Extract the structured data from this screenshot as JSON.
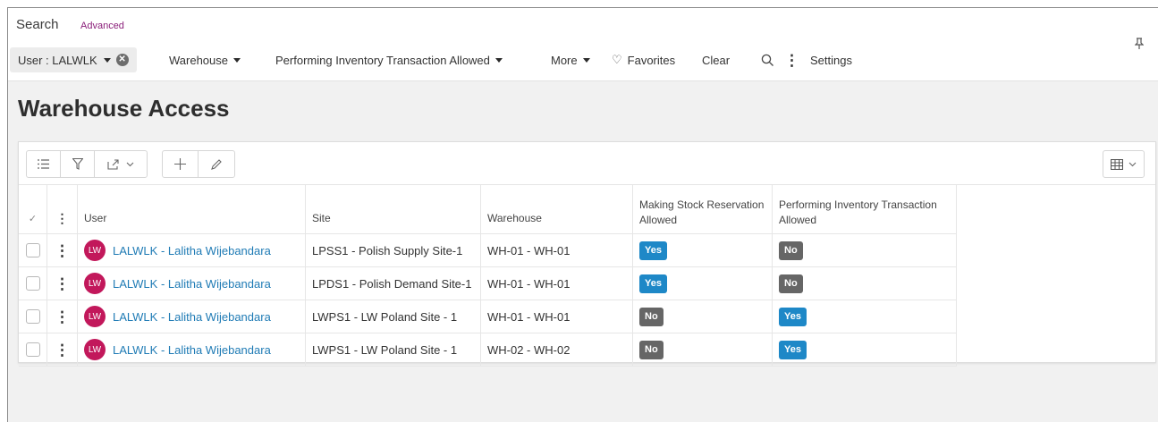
{
  "search": {
    "title": "Search",
    "advanced_label": "Advanced",
    "chip_label": "User : LALWLK",
    "filters": [
      {
        "label": "Warehouse"
      },
      {
        "label": "Performing Inventory Transaction Allowed"
      },
      {
        "label": "More"
      }
    ],
    "favorites_label": "Favorites",
    "clear_label": "Clear",
    "settings_label": "Settings"
  },
  "page": {
    "title": "Warehouse Access"
  },
  "table": {
    "columns": {
      "user": "User",
      "site": "Site",
      "warehouse": "Warehouse",
      "making_stock_reservation": "Making Stock Reservation Allowed",
      "performing_inventory_transaction": "Performing Inventory Transaction Allowed"
    },
    "rows": [
      {
        "avatar": "LW",
        "user": "LALWLK - Lalitha Wijebandara",
        "site": "LPSS1 - Polish Supply Site-1",
        "warehouse": "WH-01 - WH-01",
        "msr": "Yes",
        "pit": "No"
      },
      {
        "avatar": "LW",
        "user": "LALWLK - Lalitha Wijebandara",
        "site": "LPDS1 - Polish Demand Site-1",
        "warehouse": "WH-01 - WH-01",
        "msr": "Yes",
        "pit": "No"
      },
      {
        "avatar": "LW",
        "user": "LALWLK - Lalitha Wijebandara",
        "site": "LWPS1 - LW Poland Site - 1",
        "warehouse": "WH-01 - WH-01",
        "msr": "No",
        "pit": "Yes"
      },
      {
        "avatar": "LW",
        "user": "LALWLK - Lalitha Wijebandara",
        "site": "LWPS1 - LW Poland Site - 1",
        "warehouse": "WH-02 - WH-02",
        "msr": "No",
        "pit": "Yes"
      }
    ]
  },
  "colors": {
    "accent_link": "#1f7bb5",
    "yes_badge": "#1e88c7",
    "no_badge": "#666666",
    "avatar": "#c2185b",
    "advanced_link": "#8b1f7a"
  }
}
